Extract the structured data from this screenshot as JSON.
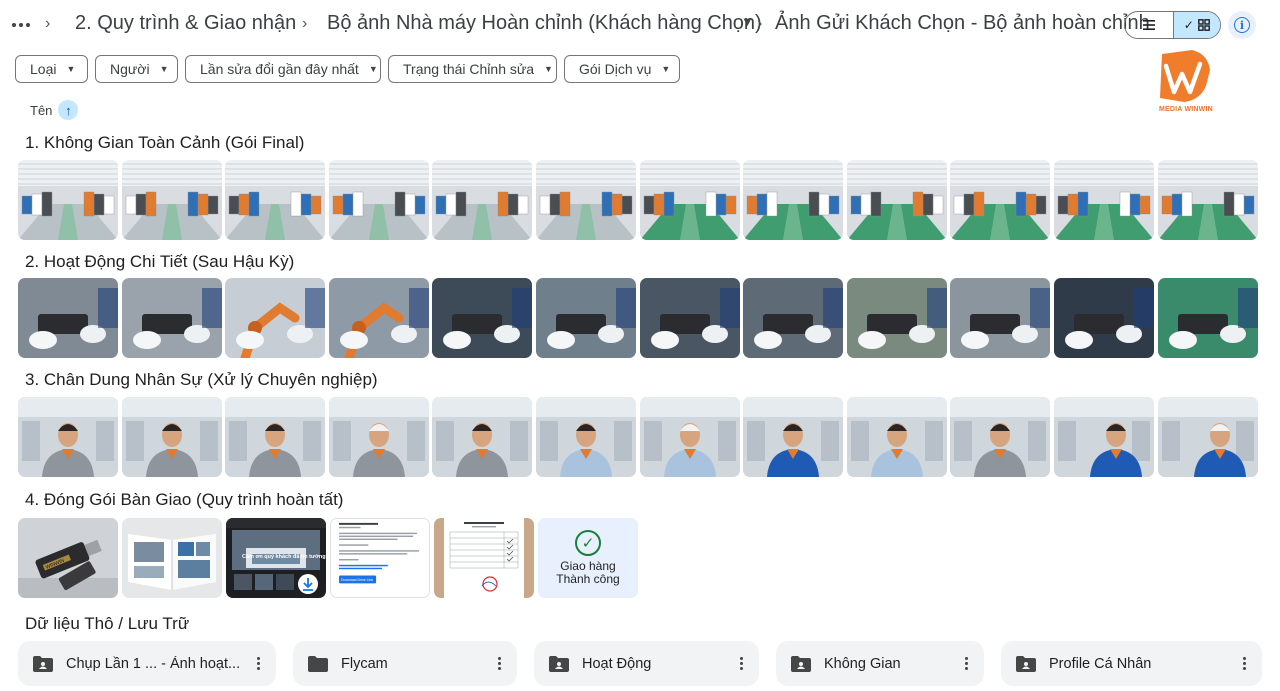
{
  "header": {
    "crumbs": [
      {
        "label": "2. Quy trình & Giao nhận"
      },
      {
        "label": "Bộ ảnh Nhà máy Hoàn chỉnh (Khách hàng Chọn)"
      },
      {
        "label": "Ảnh Gửi Khách Chọn - Bộ ảnh hoàn chỉnh"
      }
    ],
    "view_list_icon": "list-icon",
    "view_grid_icon": "grid-icon",
    "check_glyph": "✓",
    "info_glyph": "i"
  },
  "filters": [
    {
      "label": "Loại"
    },
    {
      "label": "Người"
    },
    {
      "label": "Lần sửa đổi gần đây nhất"
    },
    {
      "label": "Trạng thái Chỉnh sửa"
    },
    {
      "label": "Gói Dịch vụ"
    }
  ],
  "logo": {
    "text": "MEDIA WINWIN",
    "color": "#f07d2b"
  },
  "sort": {
    "label": "Tên",
    "arrow": "↑"
  },
  "sections": [
    {
      "title": "1. Không Gian Toàn Cảnh (Gói Final)"
    },
    {
      "title": "2. Hoạt Động Chi Tiết (Sau Hậu Kỳ)"
    },
    {
      "title": "3. Chân Dung Nhân Sự (Xử lý Chuyên nghiệp)"
    },
    {
      "title": "4. Đóng Gói Bàn Giao (Quy trình hoàn tất)"
    }
  ],
  "delivery": {
    "success_glyph": "✓",
    "success_line1": "Giao hàng",
    "success_line2": "Thành công",
    "usb_label": "WINWIN",
    "phone_text": "Cảm ơn quý khách đã tin tưởng",
    "doc_button": "Download Drive Link"
  },
  "raw_title": "Dữ liệu Thô  / Lưu Trữ",
  "folders": [
    {
      "name": "Chụp Lần 1 ... - Ảnh hoạt..."
    },
    {
      "name": "Flycam"
    },
    {
      "name": "Hoạt Động"
    },
    {
      "name": "Không Gian"
    },
    {
      "name": "Profile Cá Nhân"
    }
  ],
  "colors": {
    "accent": "#c2e7ff",
    "brand_orange": "#f07d2b",
    "success": "#188038",
    "folder_bg": "#f1f3f4"
  }
}
